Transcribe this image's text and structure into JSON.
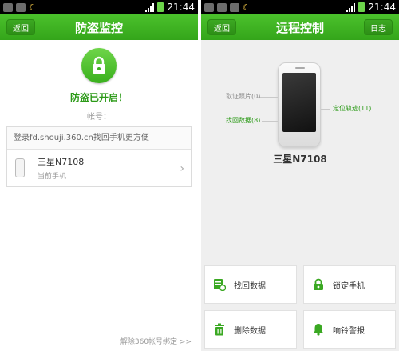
{
  "left": {
    "status_time": "21:44",
    "title": "防盗监控",
    "back_label": "返回",
    "status_text": "防盗已开启！",
    "account_label": "帐号：",
    "login_tip": "登录fd.shouji.360.cn找回手机更方便",
    "device": {
      "name": "三星N7108",
      "sub": "当前手机"
    },
    "unbind_link": "解除360帐号绑定 >>"
  },
  "right": {
    "status_time": "21:44",
    "title": "远程控制",
    "back_label": "返回",
    "log_label": "日志",
    "functions": {
      "photo": "取证照片(0)",
      "recover": "找回数据(8)",
      "locate": "定位轨迹(11)"
    },
    "model_name": "三星N7108",
    "actions": [
      {
        "label": "找回数据",
        "icon": "recover-data-icon"
      },
      {
        "label": "锁定手机",
        "icon": "lock-phone-icon"
      },
      {
        "label": "删除数据",
        "icon": "trash-icon"
      },
      {
        "label": "响铃警报",
        "icon": "bell-icon"
      }
    ]
  },
  "colors": {
    "brand_green": "#3ab01e",
    "accent_text": "#2c9a18"
  }
}
